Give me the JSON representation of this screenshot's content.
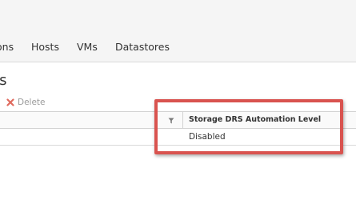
{
  "tabs": [
    {
      "label": "ons"
    },
    {
      "label": "Hosts"
    },
    {
      "label": "VMs"
    },
    {
      "label": "Datastores"
    }
  ],
  "page": {
    "title": "es"
  },
  "toolbar": {
    "delete_label": "Delete",
    "delete_icon": "close-x-icon"
  },
  "grid": {
    "filter_icon": "filter-icon",
    "columns": [
      {
        "label": "Storage DRS Automation Level"
      }
    ],
    "rows": [
      [
        "Disabled"
      ]
    ]
  },
  "colors": {
    "highlight": "#d9534f",
    "delete_icon": "#e06b5e",
    "disabled_text": "#9a9a9a"
  }
}
